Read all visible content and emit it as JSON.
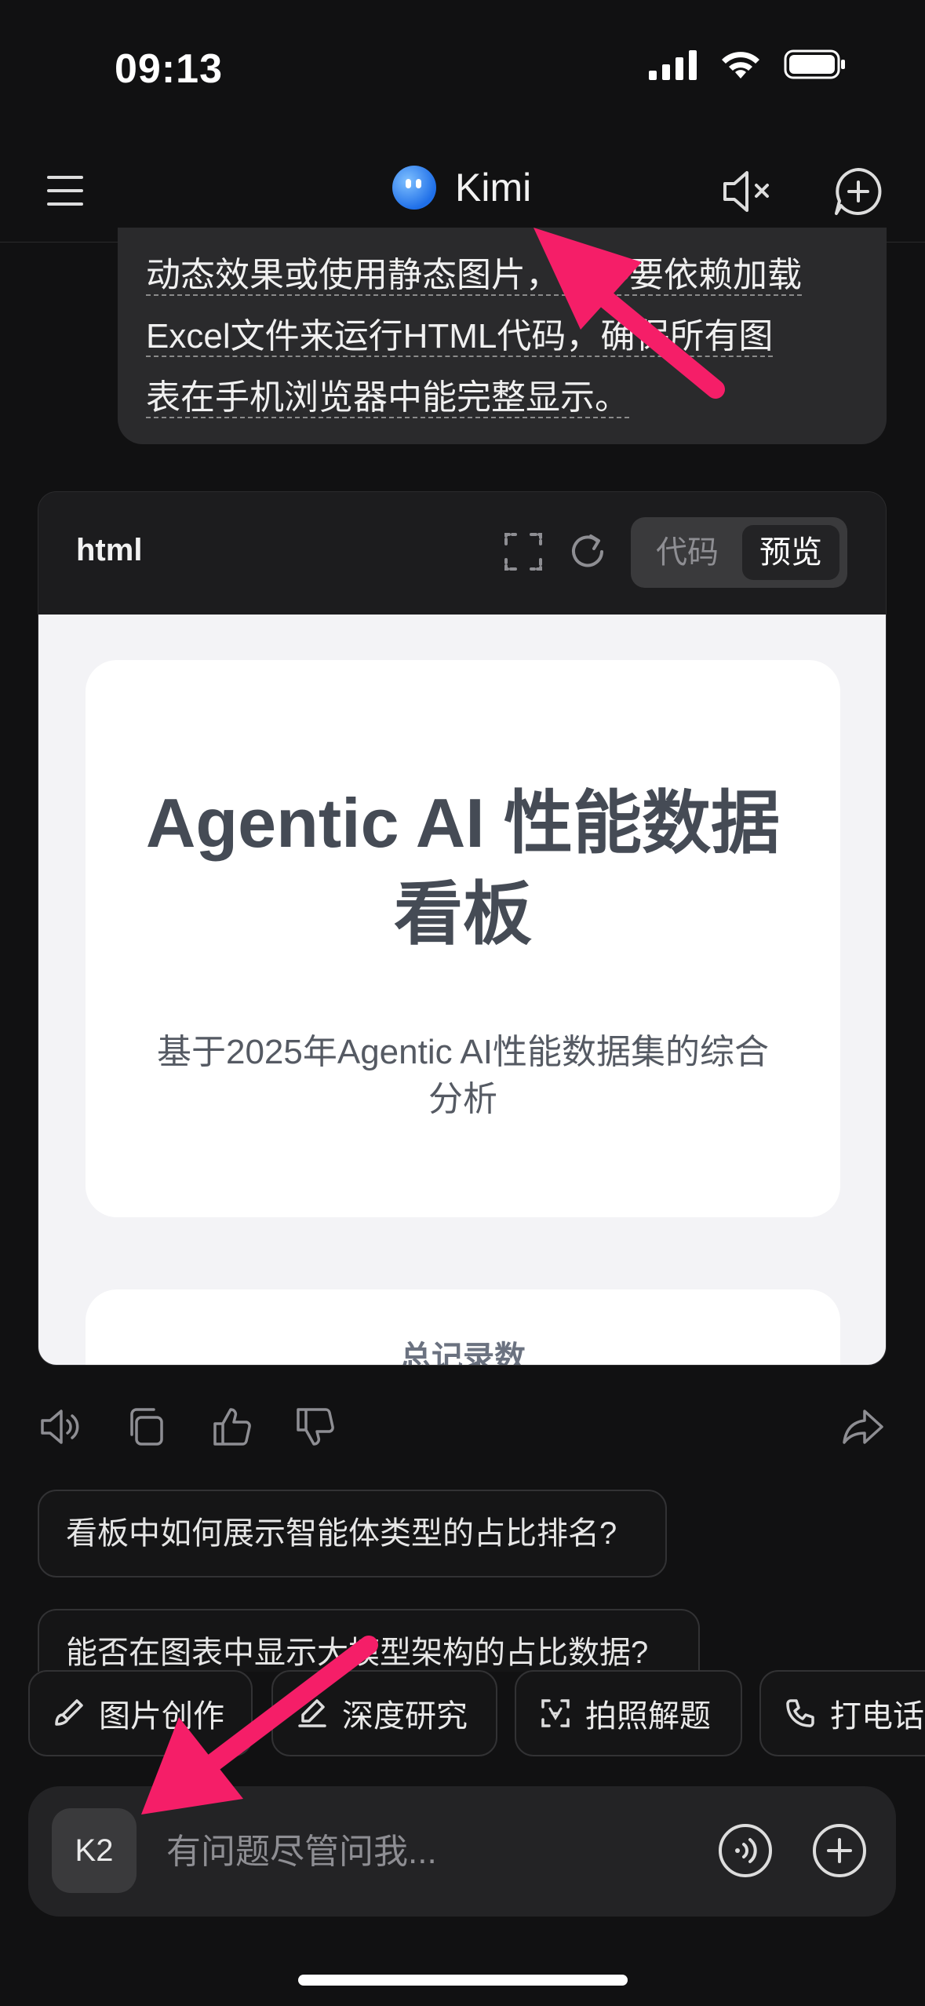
{
  "status_bar": {
    "time": "09:13"
  },
  "header": {
    "app_name": "Kimi"
  },
  "user_message": {
    "lines": [
      "动态效果或使用静态图片，也不要依赖加载",
      "Excel文件来运行HTML代码，确保所有图",
      "表在手机浏览器中能完整显示。"
    ]
  },
  "code_block": {
    "language": "html",
    "toggle": {
      "code_label": "代码",
      "preview_label": "预览",
      "selected": "预览"
    },
    "preview": {
      "title": "Agentic AI 性能数据看板",
      "subtitle": "基于2025年Agentic AI性能数据集的综合分析",
      "stat_label": "总记录数"
    }
  },
  "suggestions": [
    "看板中如何展示智能体类型的占比排名?",
    "能否在图表中显示大模型架构的占比数据?"
  ],
  "tools": [
    "图片创作",
    "深度研究",
    "拍照解题",
    "打电话"
  ],
  "input": {
    "model_label": "K2",
    "placeholder": "有问题尽管问我..."
  },
  "colors": {
    "background": "#111112",
    "annotation_arrow": "#f51e68",
    "brand": "#2f7ff0"
  }
}
